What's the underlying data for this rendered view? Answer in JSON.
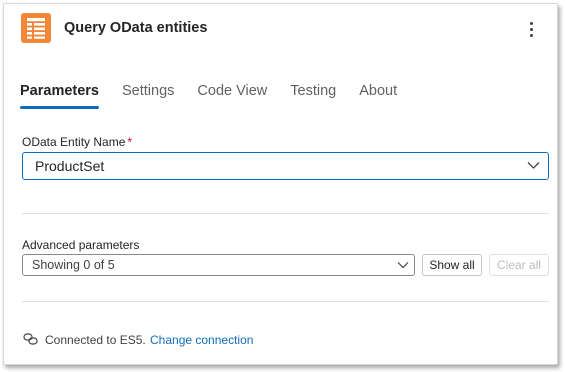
{
  "header": {
    "title": "Query OData entities",
    "icon": "table-icon",
    "icon_color": "#f1873a"
  },
  "tabs": [
    {
      "label": "Parameters",
      "active": true
    },
    {
      "label": "Settings",
      "active": false
    },
    {
      "label": "Code View",
      "active": false
    },
    {
      "label": "Testing",
      "active": false
    },
    {
      "label": "About",
      "active": false
    }
  ],
  "entity": {
    "label": "OData Entity Name",
    "required_mark": "*",
    "value": "ProductSet"
  },
  "advanced": {
    "label": "Advanced parameters",
    "value": "Showing 0 of 5",
    "show_all_label": "Show all",
    "clear_all_label": "Clear all"
  },
  "connection": {
    "text": "Connected to ES5.",
    "link_label": "Change connection"
  },
  "colors": {
    "accent": "#0f6cbd",
    "required": "#c50f1f"
  }
}
